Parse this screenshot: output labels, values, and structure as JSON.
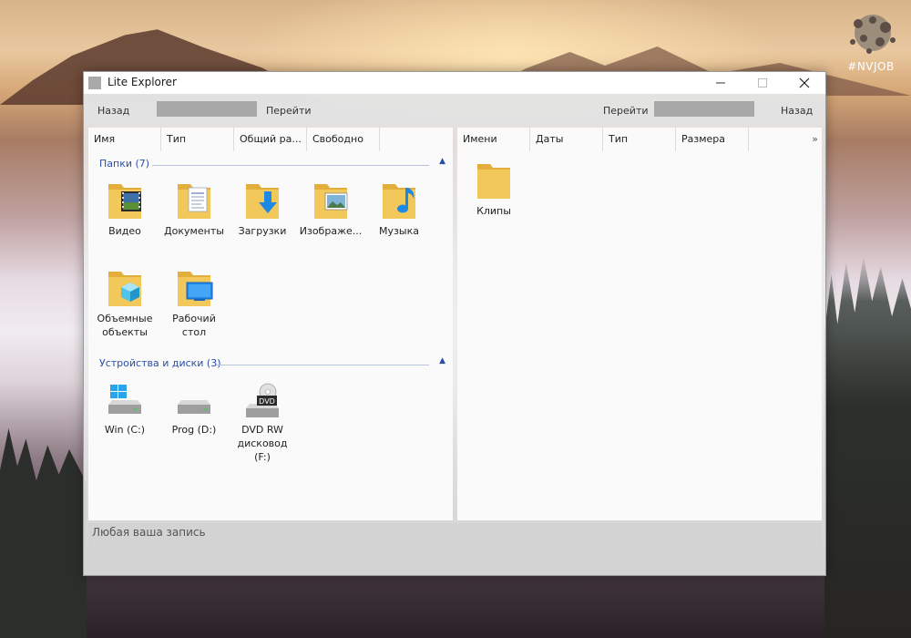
{
  "window": {
    "title": "Lite Explorer"
  },
  "toolbar": {
    "left_back": "Назад",
    "left_go": "Перейти",
    "right_go": "Перейти",
    "right_back": "Назад"
  },
  "left_pane": {
    "columns": [
      "Имя",
      "Тип",
      "Общий ра...",
      "Свободно"
    ],
    "groups": {
      "folders": {
        "title": "Папки (7)",
        "items": [
          "Видео",
          "Документы",
          "Загрузки",
          "Изображе...",
          "Музыка",
          "Объемные объекты",
          "Рабочий стол"
        ]
      },
      "drives": {
        "title": "Устройства и диски (3)",
        "items": [
          "Win (C:)",
          "Prog (D:)",
          "DVD RW дисковод (F:)"
        ],
        "dvd_badge": "DVD"
      }
    }
  },
  "right_pane": {
    "columns": [
      "Имени",
      "Даты",
      "Тип",
      "Размера"
    ],
    "more": "»",
    "items": [
      "Клипы"
    ]
  },
  "statusbar": {
    "text": "Любая ваша запись"
  },
  "desktop": {
    "watermark": "#NVJOB"
  },
  "colors": {
    "folder": "#f3c85b",
    "folder_dark": "#e3ae3c",
    "group_title": "#2a4fa8",
    "accent_blue": "#1e88e5"
  }
}
